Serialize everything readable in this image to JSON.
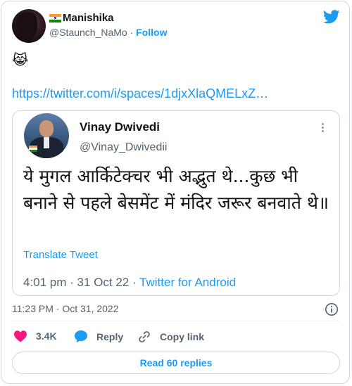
{
  "author": {
    "flag_icon": "india-flag-icon",
    "display_name": "Manishika",
    "handle": "@Staunch_NaMo",
    "separator": "·",
    "follow_label": "Follow"
  },
  "tweet": {
    "emoji": "😹",
    "link": "https://twitter.com/i/spaces/1djxXlaQMELxZ…",
    "timestamp": "11:23 PM · Oct 31, 2022"
  },
  "quoted": {
    "name": "Vinay Dwivedi",
    "handle": "@Vinay_Dwivedii",
    "text": "ये मुगल आर्किटेक्चर भी अद्भुत थे...कुछ भी बनाने से पहले बेसमेंट में मंदिर जरूर बनवाते थे॥",
    "translate_label": "Translate Tweet",
    "meta_time": "4:01 pm · 31 Oct 22 · ",
    "meta_source": "Twitter for Android"
  },
  "actions": {
    "like_count": "3.4K",
    "reply_label": "Reply",
    "copy_label": "Copy link",
    "read_replies_label": "Read 60 replies"
  },
  "colors": {
    "accent": "#1d9bf0",
    "like": "#f91880",
    "muted": "#536471"
  }
}
